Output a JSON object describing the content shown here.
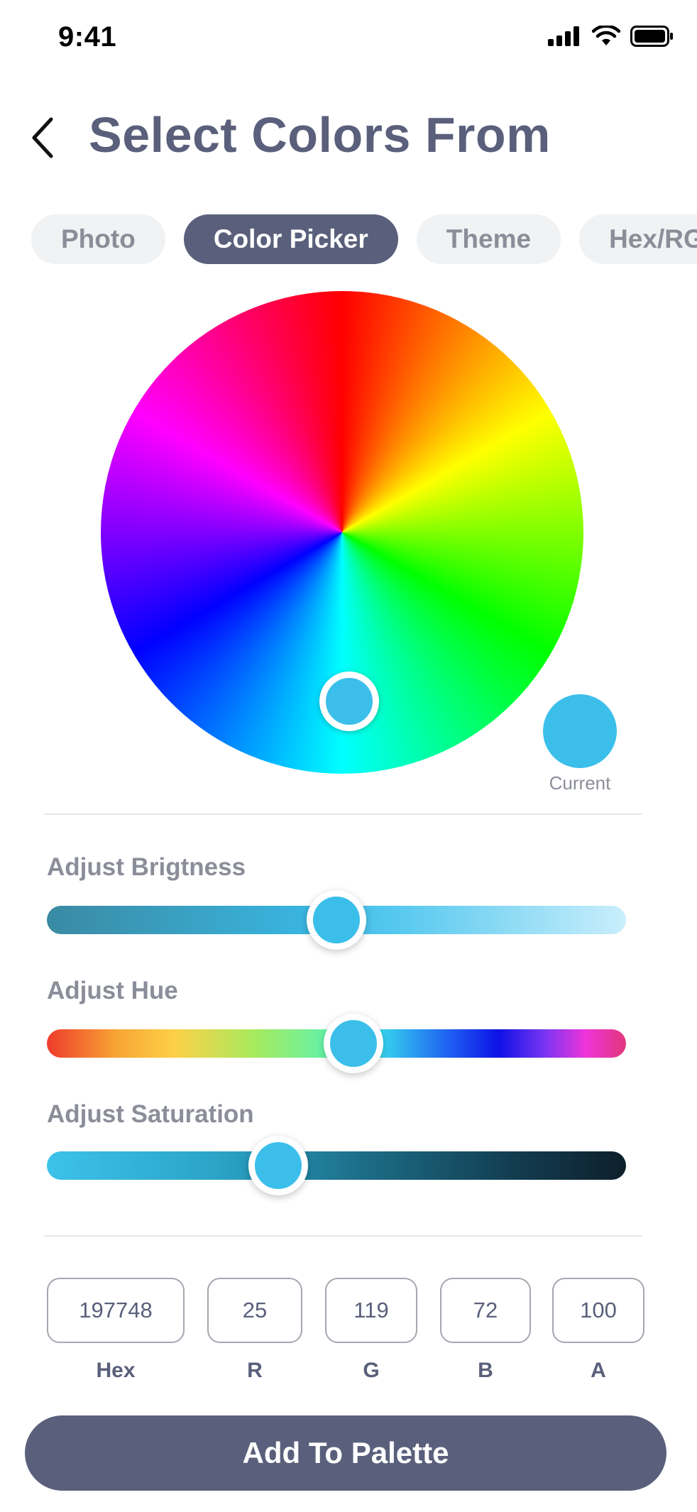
{
  "status_bar": {
    "time": "9:41",
    "icons": [
      "cellular-signal-icon",
      "wifi-icon",
      "battery-icon"
    ]
  },
  "header": {
    "back_icon": "chevron-left-icon",
    "title": "Select Colors From"
  },
  "tabs": [
    {
      "label": "Photo",
      "active": false
    },
    {
      "label": "Color Picker",
      "active": true
    },
    {
      "label": "Theme",
      "active": false
    },
    {
      "label": "Hex/RGB",
      "active": false
    }
  ],
  "picker": {
    "selected_color": "#3bbfea",
    "current_label": "Current"
  },
  "sliders": {
    "brightness": {
      "label": "Adjust Brigtness",
      "value_percent": 50
    },
    "hue": {
      "label": "Adjust Hue",
      "value_percent": 53
    },
    "saturation": {
      "label": "Adjust Saturation",
      "value_percent": 40
    }
  },
  "values": [
    {
      "label": "Hex",
      "value": "197748"
    },
    {
      "label": "R",
      "value": "25"
    },
    {
      "label": "G",
      "value": "119"
    },
    {
      "label": "B",
      "value": "72"
    },
    {
      "label": "A",
      "value": "100"
    }
  ],
  "colors": {
    "primary": "#5a607b",
    "muted_text": "#8b8e99",
    "tab_bg": "#f1f2f4"
  },
  "add_button": {
    "label": "Add To Palette"
  }
}
